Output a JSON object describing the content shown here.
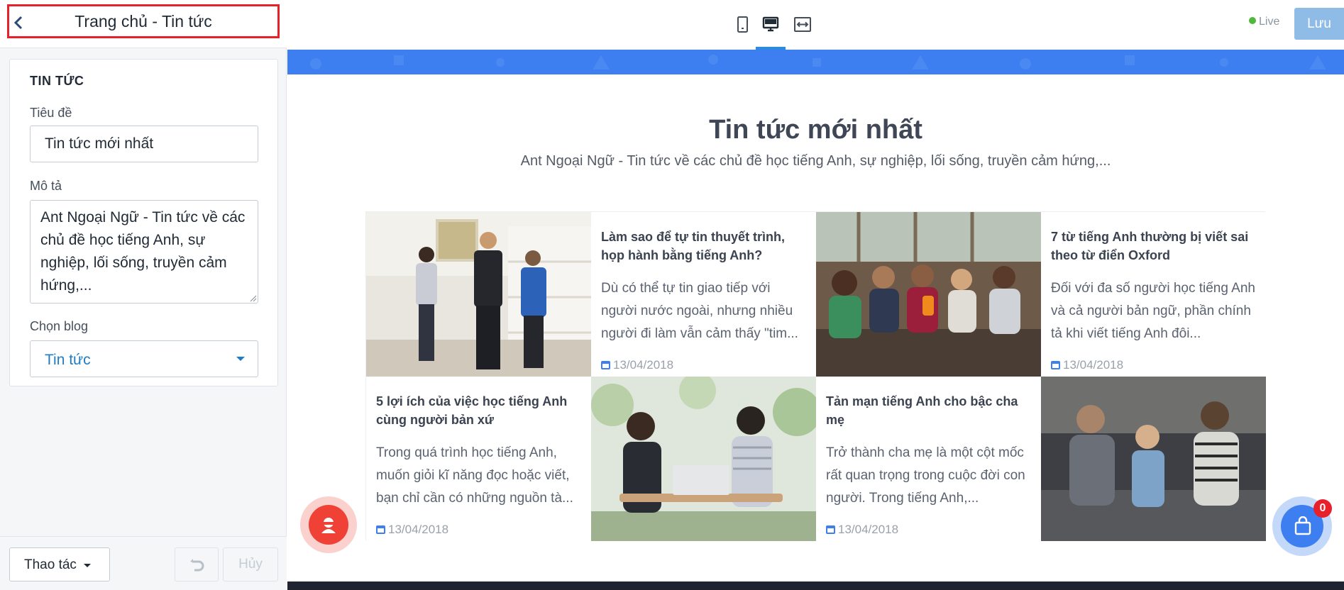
{
  "editor": {
    "header": {
      "title": "Trang chủ - Tin tức"
    },
    "section": {
      "title": "TIN TỨC",
      "fields": {
        "title_label": "Tiêu đề",
        "title_value": "Tin tức mới nhất",
        "description_label": "Mô tả",
        "description_value": "Ant Ngoại Ngữ - Tin tức về các chủ đề học tiếng Anh, sự nghiệp, lối sống, truyền cảm hứng,...",
        "blog_label": "Chọn blog",
        "blog_value": "Tin tức"
      }
    },
    "footer": {
      "actions_label": "Thao tác",
      "cancel_label": "Hủy"
    }
  },
  "toolbar": {
    "devices": [
      "mobile-icon",
      "desktop-icon",
      "full-width-icon"
    ],
    "active_device": "desktop",
    "status_label": "Live",
    "save_label": "Lưu"
  },
  "preview": {
    "heading": "Tin tức mới nhất",
    "subheading": "Ant Ngoại Ngữ - Tin tức về các chủ đề học tiếng Anh, sự nghiệp, lối sống, truyền cảm hứng,...",
    "articles": [
      {
        "title": "Làm sao để tự tin thuyết trình, họp hành bằng tiếng Anh?",
        "excerpt": "Dù có thể tự tin giao tiếp với người nước ngoài, nhưng nhiều người đi làm vẫn cảm thấy \"tim...",
        "date": "13/04/2018"
      },
      {
        "title": "7 từ tiếng Anh thường bị viết sai theo từ điển Oxford",
        "excerpt": "Đối với đa số người học tiếng Anh và cả người bản ngữ, phần chính tả khi viết tiếng Anh đôi...",
        "date": "13/04/2018"
      },
      {
        "title": "5 lợi ích của việc học tiếng Anh cùng người bản xứ",
        "excerpt": "Trong quá trình học tiếng Anh, muốn giỏi kĩ năng đọc hoặc viết, bạn chỉ cần có những nguồn tà...",
        "date": "13/04/2018"
      },
      {
        "title": "Tản mạn tiếng Anh cho bậc cha mẹ",
        "excerpt": "Trở thành cha mẹ là một cột mốc rất quan trọng trong cuộc đời con người. Trong tiếng Anh,...",
        "date": "13/04/2018"
      }
    ],
    "cart_count": "0"
  },
  "colors": {
    "accent_blue": "#3d7ef0",
    "header_frame_red": "#e8202a",
    "live_green": "#50b83c",
    "link_blue": "#1e7bc6"
  }
}
